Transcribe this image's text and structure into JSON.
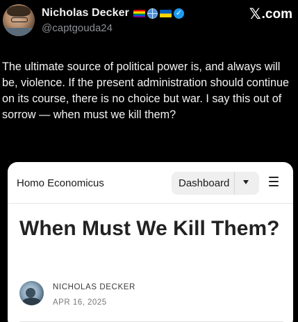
{
  "tweet": {
    "display_name": "Nicholas Decker",
    "handle": "@captgouda24",
    "badges": [
      "rainbow-flag-icon",
      "globe-icon",
      "ukraine-flag-icon",
      "verified-badge-icon"
    ],
    "verified_mark": "✓",
    "body": "The ultimate source of political power is, and always will be, violence. If the present administration should continue on its course, there is no choice but war. I say this out of sorrow — when must we kill them?"
  },
  "watermark": {
    "x_mark": "𝕏",
    "text": ".com"
  },
  "card": {
    "site_name": "Homo Economicus",
    "dashboard_label": "Dashboard",
    "article_title": "When Must We Kill Them?",
    "author_name": "NICHOLAS DECKER",
    "post_date": "APR 16, 2025"
  }
}
